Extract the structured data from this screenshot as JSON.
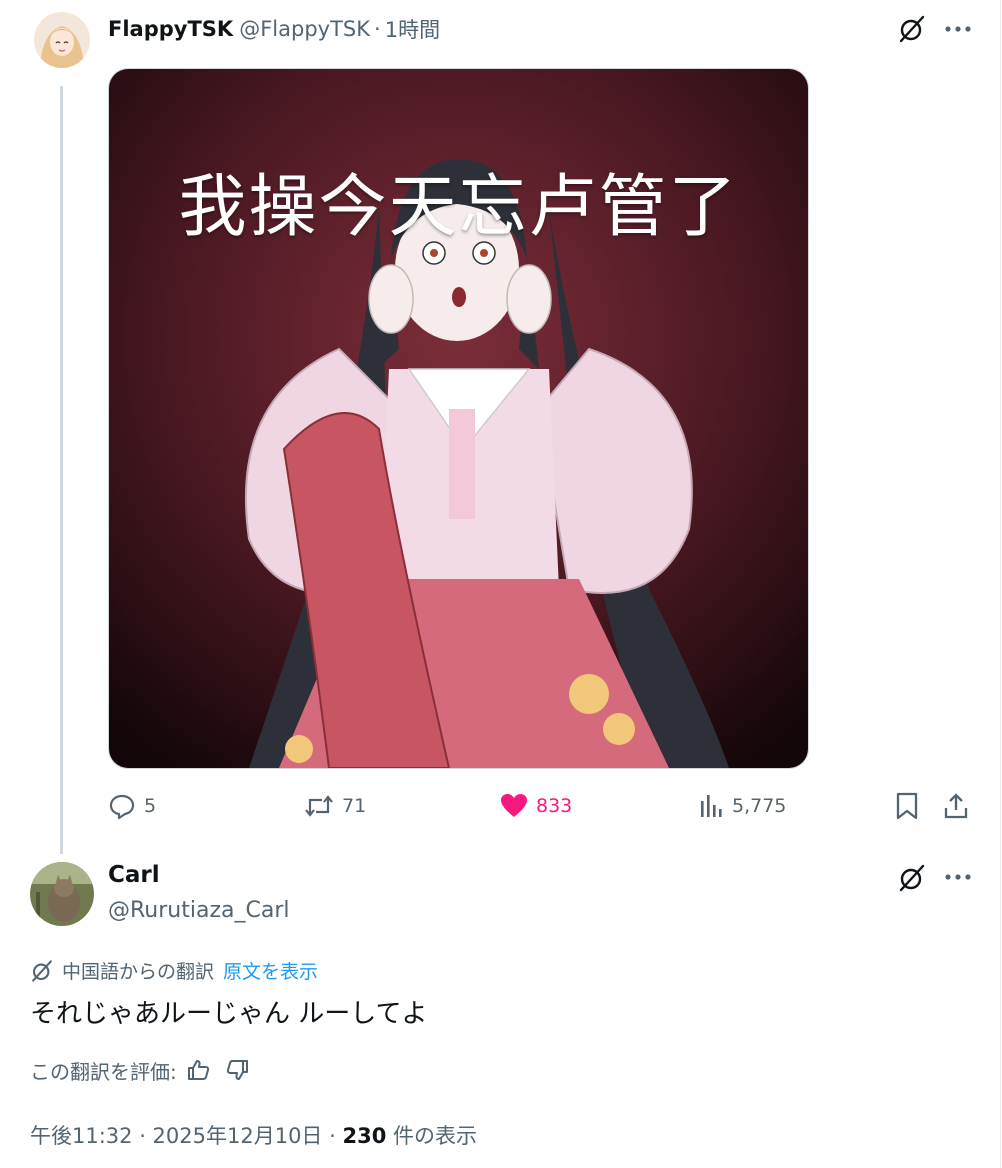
{
  "tweet": {
    "author_name": "FlappyTSK",
    "author_handle": "@FlappyTSK",
    "separator": "·",
    "time": "1時間",
    "image_caption": "我操今天忘卢管了",
    "actions": {
      "replies": "5",
      "retweets": "71",
      "likes": "833",
      "views": "5,775"
    }
  },
  "reply": {
    "author_name": "Carl",
    "author_handle": "@Rurutiaza_Carl",
    "translated_from": "中国語からの翻訳",
    "show_original": "原文を表示",
    "text": "それじゃあルーじゃん ルーしてよ",
    "rate_translation": "この翻訳を評価:",
    "timestamp": "午後11:32 · 2025年12月10日",
    "separator": "·",
    "view_count": "230",
    "views_label": "件の表示"
  },
  "colors": {
    "text_primary": "#0f1419",
    "text_secondary": "#536471",
    "link": "#1d9bf0",
    "like_active": "#f91880",
    "thread_line": "#cfd9de"
  },
  "icons": [
    "grok-icon",
    "more-icon",
    "reply-icon",
    "retweet-icon",
    "heart-icon",
    "views-icon",
    "bookmark-icon",
    "share-icon",
    "translate-icon",
    "thumbs-up-icon",
    "thumbs-down-icon"
  ]
}
